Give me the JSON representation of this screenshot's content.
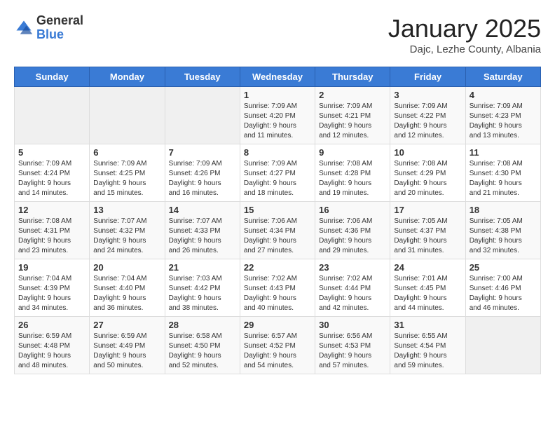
{
  "header": {
    "logo_general": "General",
    "logo_blue": "Blue",
    "month": "January 2025",
    "location": "Dajc, Lezhe County, Albania"
  },
  "weekdays": [
    "Sunday",
    "Monday",
    "Tuesday",
    "Wednesday",
    "Thursday",
    "Friday",
    "Saturday"
  ],
  "weeks": [
    [
      {
        "day": "",
        "info": ""
      },
      {
        "day": "",
        "info": ""
      },
      {
        "day": "",
        "info": ""
      },
      {
        "day": "1",
        "info": "Sunrise: 7:09 AM\nSunset: 4:20 PM\nDaylight: 9 hours\nand 11 minutes."
      },
      {
        "day": "2",
        "info": "Sunrise: 7:09 AM\nSunset: 4:21 PM\nDaylight: 9 hours\nand 12 minutes."
      },
      {
        "day": "3",
        "info": "Sunrise: 7:09 AM\nSunset: 4:22 PM\nDaylight: 9 hours\nand 12 minutes."
      },
      {
        "day": "4",
        "info": "Sunrise: 7:09 AM\nSunset: 4:23 PM\nDaylight: 9 hours\nand 13 minutes."
      }
    ],
    [
      {
        "day": "5",
        "info": "Sunrise: 7:09 AM\nSunset: 4:24 PM\nDaylight: 9 hours\nand 14 minutes."
      },
      {
        "day": "6",
        "info": "Sunrise: 7:09 AM\nSunset: 4:25 PM\nDaylight: 9 hours\nand 15 minutes."
      },
      {
        "day": "7",
        "info": "Sunrise: 7:09 AM\nSunset: 4:26 PM\nDaylight: 9 hours\nand 16 minutes."
      },
      {
        "day": "8",
        "info": "Sunrise: 7:09 AM\nSunset: 4:27 PM\nDaylight: 9 hours\nand 18 minutes."
      },
      {
        "day": "9",
        "info": "Sunrise: 7:08 AM\nSunset: 4:28 PM\nDaylight: 9 hours\nand 19 minutes."
      },
      {
        "day": "10",
        "info": "Sunrise: 7:08 AM\nSunset: 4:29 PM\nDaylight: 9 hours\nand 20 minutes."
      },
      {
        "day": "11",
        "info": "Sunrise: 7:08 AM\nSunset: 4:30 PM\nDaylight: 9 hours\nand 21 minutes."
      }
    ],
    [
      {
        "day": "12",
        "info": "Sunrise: 7:08 AM\nSunset: 4:31 PM\nDaylight: 9 hours\nand 23 minutes."
      },
      {
        "day": "13",
        "info": "Sunrise: 7:07 AM\nSunset: 4:32 PM\nDaylight: 9 hours\nand 24 minutes."
      },
      {
        "day": "14",
        "info": "Sunrise: 7:07 AM\nSunset: 4:33 PM\nDaylight: 9 hours\nand 26 minutes."
      },
      {
        "day": "15",
        "info": "Sunrise: 7:06 AM\nSunset: 4:34 PM\nDaylight: 9 hours\nand 27 minutes."
      },
      {
        "day": "16",
        "info": "Sunrise: 7:06 AM\nSunset: 4:36 PM\nDaylight: 9 hours\nand 29 minutes."
      },
      {
        "day": "17",
        "info": "Sunrise: 7:05 AM\nSunset: 4:37 PM\nDaylight: 9 hours\nand 31 minutes."
      },
      {
        "day": "18",
        "info": "Sunrise: 7:05 AM\nSunset: 4:38 PM\nDaylight: 9 hours\nand 32 minutes."
      }
    ],
    [
      {
        "day": "19",
        "info": "Sunrise: 7:04 AM\nSunset: 4:39 PM\nDaylight: 9 hours\nand 34 minutes."
      },
      {
        "day": "20",
        "info": "Sunrise: 7:04 AM\nSunset: 4:40 PM\nDaylight: 9 hours\nand 36 minutes."
      },
      {
        "day": "21",
        "info": "Sunrise: 7:03 AM\nSunset: 4:42 PM\nDaylight: 9 hours\nand 38 minutes."
      },
      {
        "day": "22",
        "info": "Sunrise: 7:02 AM\nSunset: 4:43 PM\nDaylight: 9 hours\nand 40 minutes."
      },
      {
        "day": "23",
        "info": "Sunrise: 7:02 AM\nSunset: 4:44 PM\nDaylight: 9 hours\nand 42 minutes."
      },
      {
        "day": "24",
        "info": "Sunrise: 7:01 AM\nSunset: 4:45 PM\nDaylight: 9 hours\nand 44 minutes."
      },
      {
        "day": "25",
        "info": "Sunrise: 7:00 AM\nSunset: 4:46 PM\nDaylight: 9 hours\nand 46 minutes."
      }
    ],
    [
      {
        "day": "26",
        "info": "Sunrise: 6:59 AM\nSunset: 4:48 PM\nDaylight: 9 hours\nand 48 minutes."
      },
      {
        "day": "27",
        "info": "Sunrise: 6:59 AM\nSunset: 4:49 PM\nDaylight: 9 hours\nand 50 minutes."
      },
      {
        "day": "28",
        "info": "Sunrise: 6:58 AM\nSunset: 4:50 PM\nDaylight: 9 hours\nand 52 minutes."
      },
      {
        "day": "29",
        "info": "Sunrise: 6:57 AM\nSunset: 4:52 PM\nDaylight: 9 hours\nand 54 minutes."
      },
      {
        "day": "30",
        "info": "Sunrise: 6:56 AM\nSunset: 4:53 PM\nDaylight: 9 hours\nand 57 minutes."
      },
      {
        "day": "31",
        "info": "Sunrise: 6:55 AM\nSunset: 4:54 PM\nDaylight: 9 hours\nand 59 minutes."
      },
      {
        "day": "",
        "info": ""
      }
    ]
  ]
}
